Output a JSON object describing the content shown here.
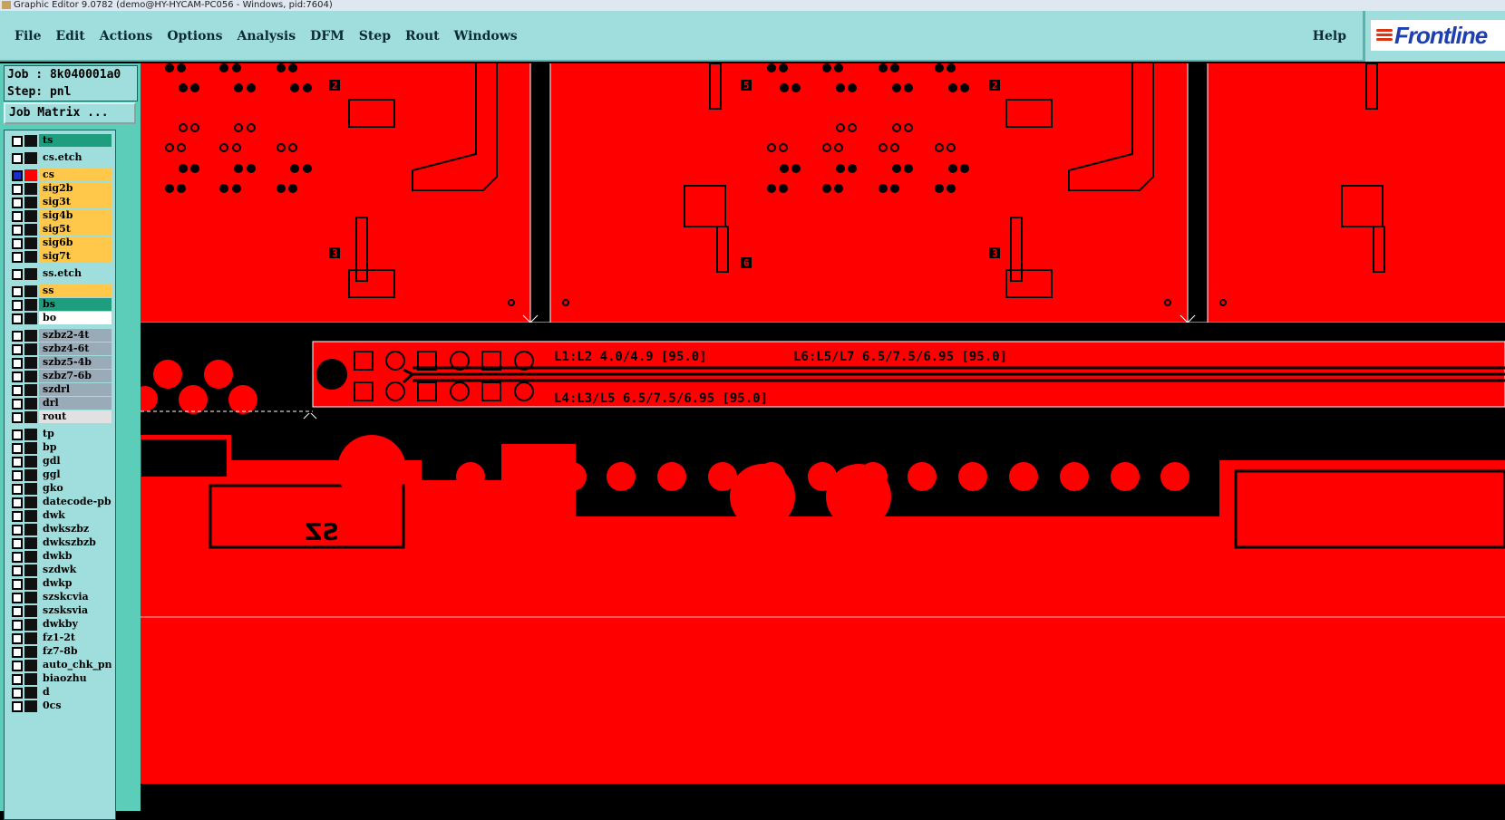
{
  "window": {
    "title": "Graphic Editor 9.0782 (demo@HY-HYCAM-PC056 - Windows, pid:7604)"
  },
  "menubar": {
    "items": [
      "File",
      "Edit",
      "Actions",
      "Options",
      "Analysis",
      "DFM",
      "Step",
      "Rout",
      "Windows"
    ],
    "help": "Help",
    "logo": "Frontline"
  },
  "job": {
    "job_line": "Job : 8k040001a0",
    "step_line": "Step: pnl",
    "matrix_button": "Job Matrix ..."
  },
  "colors": {
    "board": "#ff0000",
    "ink": "#000000",
    "panel": "#9fdedc"
  },
  "layers": [
    {
      "name": "ts",
      "color": "#1e9e7e"
    },
    {
      "name": "cs.etch",
      "color": "#9fdedc"
    },
    {
      "name": "cs",
      "color": "#ffc84a",
      "active": true
    },
    {
      "name": "sig2b",
      "color": "#ffc84a"
    },
    {
      "name": "sig3t",
      "color": "#ffc84a"
    },
    {
      "name": "sig4b",
      "color": "#ffc84a"
    },
    {
      "name": "sig5t",
      "color": "#ffc84a"
    },
    {
      "name": "sig6b",
      "color": "#ffc84a"
    },
    {
      "name": "sig7t",
      "color": "#ffc84a"
    },
    {
      "name": "ss.etch",
      "color": "#9fdedc"
    },
    {
      "name": "ss",
      "color": "#ffc84a"
    },
    {
      "name": "bs",
      "color": "#1e9e7e"
    },
    {
      "name": "bo",
      "color": "#ffffff"
    },
    {
      "name": "szbz2-4t",
      "color": "#9aabb8"
    },
    {
      "name": "szbz4-6t",
      "color": "#9aabb8"
    },
    {
      "name": "szbz5-4b",
      "color": "#9aabb8"
    },
    {
      "name": "szbz7-6b",
      "color": "#9aabb8"
    },
    {
      "name": "szdrl",
      "color": "#9aabb8"
    },
    {
      "name": "drl",
      "color": "#9aabb8"
    },
    {
      "name": "rout",
      "color": "#e1e1e1"
    },
    {
      "name": "tp",
      "color": "#9fdedc"
    },
    {
      "name": "bp",
      "color": "#9fdedc"
    },
    {
      "name": "gdl",
      "color": "#9fdedc"
    },
    {
      "name": "ggl",
      "color": "#9fdedc"
    },
    {
      "name": "gko",
      "color": "#9fdedc"
    },
    {
      "name": "datecode-pbo",
      "color": "#9fdedc"
    },
    {
      "name": "dwk",
      "color": "#9fdedc"
    },
    {
      "name": "dwkszbz",
      "color": "#9fdedc"
    },
    {
      "name": "dwkszbzb",
      "color": "#9fdedc"
    },
    {
      "name": "dwkb",
      "color": "#9fdedc"
    },
    {
      "name": "szdwk",
      "color": "#9fdedc"
    },
    {
      "name": "dwkp",
      "color": "#9fdedc"
    },
    {
      "name": "szskcvia",
      "color": "#9fdedc"
    },
    {
      "name": "szsksvia",
      "color": "#9fdedc"
    },
    {
      "name": "dwkby",
      "color": "#9fdedc"
    },
    {
      "name": "fz1-2t",
      "color": "#9fdedc"
    },
    {
      "name": "fz7-8b",
      "color": "#9fdedc"
    },
    {
      "name": "auto_chk_pnl",
      "color": "#9fdedc"
    },
    {
      "name": "biaozhu",
      "color": "#9fdedc"
    },
    {
      "name": "d",
      "color": "#9fdedc"
    },
    {
      "name": "0cs",
      "color": "#9fdedc"
    }
  ],
  "canvas": {
    "coupon_text_1": "L1:L2 4.0/4.9 [95.0]",
    "coupon_text_2": "L6:L5/L7 6.5/7.5/6.95 [95.0]",
    "coupon_text_3": "L4:L3/L5 6.5/7.5/6.95 [95.0]",
    "mirrored_label": "SZ",
    "silk_marks": [
      "2",
      "2",
      "5",
      "3",
      "3",
      "6"
    ]
  }
}
